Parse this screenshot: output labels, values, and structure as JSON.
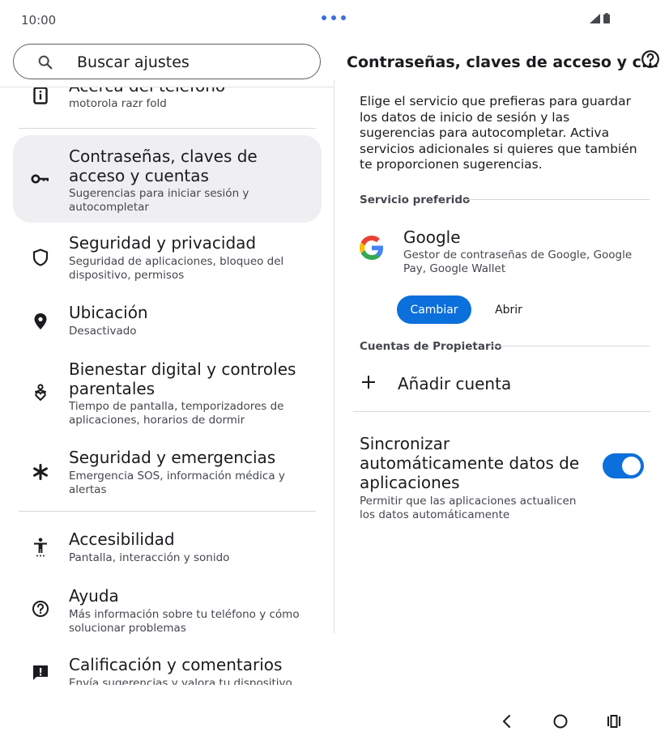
{
  "status_bar": {
    "time": "10:00"
  },
  "search": {
    "placeholder": "Buscar ajustes"
  },
  "settings_list": [
    {
      "id": "about",
      "title": "Acerca del teléfono",
      "subtitle": "motorola razr fold",
      "icon": "phone-info-icon"
    },
    {
      "id": "passwords",
      "title": "Contraseñas, claves de acceso y cuentas",
      "subtitle": "Sugerencias para iniciar sesión y autocompletar",
      "icon": "key-icon",
      "selected": true
    },
    {
      "id": "security",
      "title": "Seguridad y privacidad",
      "subtitle": "Seguridad de aplicaciones, bloqueo del dispositivo, permisos",
      "icon": "shield-icon"
    },
    {
      "id": "location",
      "title": "Ubicación",
      "subtitle": "Desactivado",
      "icon": "location-pin-icon"
    },
    {
      "id": "wellbeing",
      "title": "Bienestar digital y controles parentales",
      "subtitle": "Tiempo de pantalla, temporizadores de aplicaciones, horarios de dormir",
      "icon": "wellbeing-icon"
    },
    {
      "id": "emergency",
      "title": "Seguridad y emergencias",
      "subtitle": "Emergencia SOS, información médica y alertas",
      "icon": "asterisk-icon"
    },
    {
      "id": "accessibility",
      "title": "Accesibilidad",
      "subtitle": "Pantalla, interacción y sonido",
      "icon": "accessibility-icon"
    },
    {
      "id": "help",
      "title": "Ayuda",
      "subtitle": "Más información sobre tu teléfono y cómo solucionar problemas",
      "icon": "help-circle-icon"
    },
    {
      "id": "feedback",
      "title": "Calificación y comentarios",
      "subtitle": "Envía sugerencias y valora tu dispositivo",
      "icon": "feedback-icon"
    }
  ],
  "detail": {
    "title": "Contraseñas, claves de acceso y c...",
    "description": "Elige el servicio que prefieras para guardar los datos de inicio de sesión y las sugerencias para autocompletar. Activa servicios adicionales si quieres que también te proporcionen sugerencias.",
    "preferred_heading": "Servicio preferido",
    "service": {
      "name": "Google",
      "description": "Gestor de contraseñas de Google, Google Pay, Google Wallet",
      "change_label": "Cambiar",
      "open_label": "Abrir"
    },
    "accounts_heading": "Cuentas de Propietario",
    "add_account_label": "Añadir cuenta",
    "sync": {
      "title": "Sincronizar automáticamente datos de aplicaciones",
      "subtitle": "Permitir que las aplicaciones actualicen los datos automáticamente",
      "enabled": true
    }
  },
  "colors": {
    "accent": "#0b6fdc",
    "selected_bg": "#efeff2"
  }
}
